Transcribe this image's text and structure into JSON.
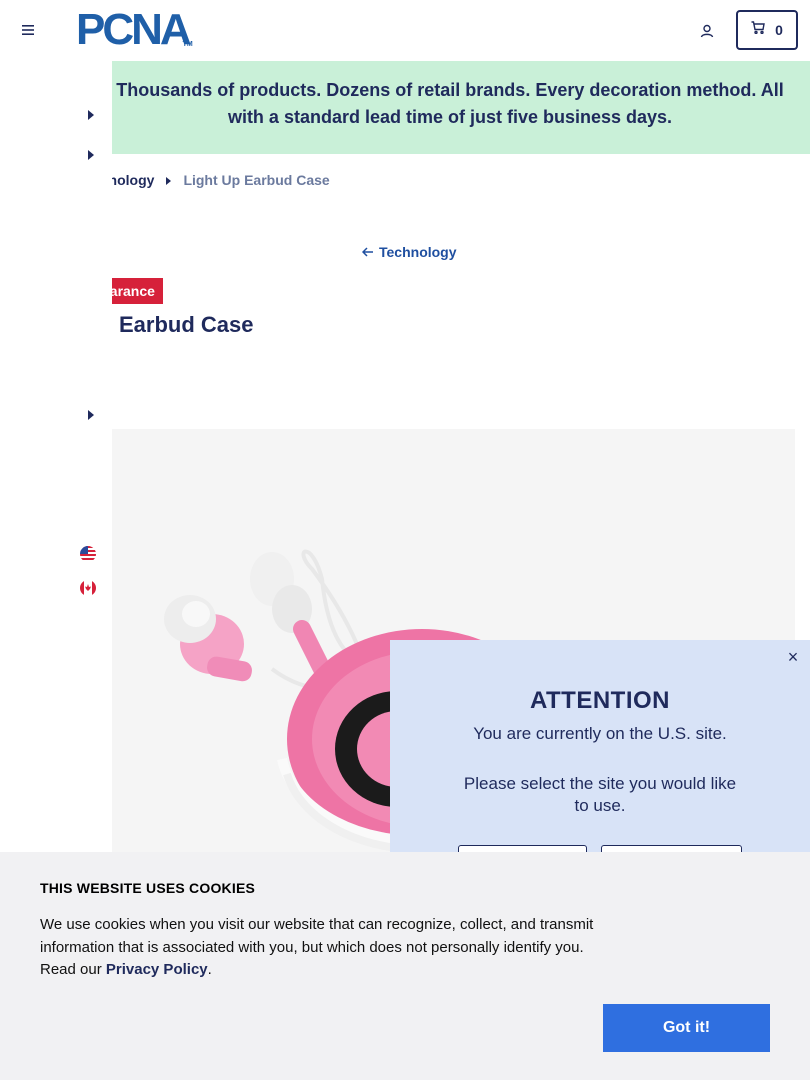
{
  "header": {
    "logo_text": "PCNA",
    "logo_tm": "TM",
    "cart_count": "0"
  },
  "banner": {
    "text": "Thousands of products. Dozens of retail brands. Every decoration method. All with a standard lead time of just five business days."
  },
  "breadcrumb": {
    "parent": "nnology",
    "current": "Light Up Earbud Case"
  },
  "back_link": "Technology",
  "product": {
    "badge": "earance",
    "title": "Earbud Case"
  },
  "modal": {
    "close": "×",
    "title": "ATTENTION",
    "message1": "You are currently on the U.S. site.",
    "message2": "Please select the site you would like to use."
  },
  "cookie": {
    "title": "THIS WEBSITE USES COOKIES",
    "body": "We use cookies when you visit our website that can recognize, collect, and transmit information that is associated with you, but which does not personally identify you. Read our",
    "link": "Privacy Policy",
    "period": ".",
    "button": "Got it!"
  },
  "colors": {
    "navy": "#1f2a5c",
    "logo_blue": "#1f5fa8",
    "banner_bg": "#c9f0d8",
    "badge_red": "#d6213a",
    "modal_bg": "#d8e3f7",
    "button_blue": "#2f6fe0"
  },
  "icons": [
    "hamburger-icon",
    "account-icon",
    "cart-icon",
    "caret-right-icon",
    "arrow-left-icon",
    "us-flag-icon",
    "canada-flag-icon",
    "close-icon"
  ]
}
